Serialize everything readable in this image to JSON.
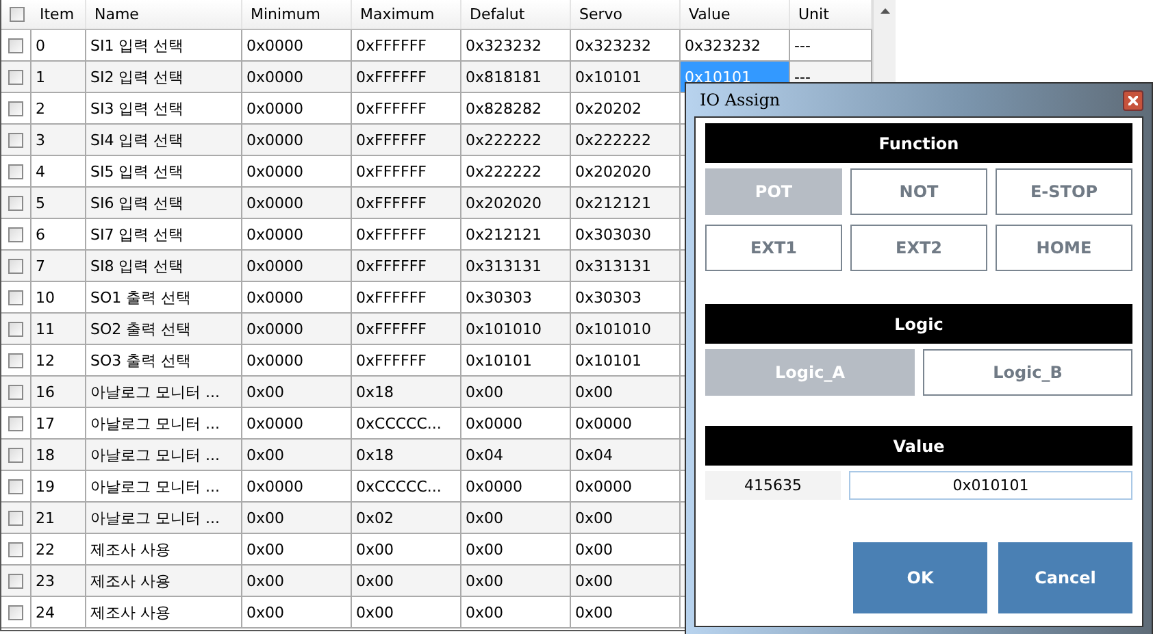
{
  "table": {
    "header_checked": false,
    "columns": [
      "Item",
      "Name",
      "Minimum",
      "Maximum",
      "Defalut",
      "Servo",
      "Value",
      "Unit"
    ],
    "rows": [
      {
        "checked": false,
        "cells": [
          "0",
          "SI1 입력 선택",
          "0x0000",
          "0xFFFFFF",
          "0x323232",
          "0x323232",
          "0x323232",
          "---"
        ],
        "value_selected": false
      },
      {
        "checked": false,
        "cells": [
          "1",
          "SI2 입력 선택",
          "0x0000",
          "0xFFFFFF",
          "0x818181",
          "0x10101",
          "0x10101",
          "---"
        ],
        "value_selected": true
      },
      {
        "checked": false,
        "cells": [
          "2",
          "SI3 입력 선택",
          "0x0000",
          "0xFFFFFF",
          "0x828282",
          "0x20202"
        ]
      },
      {
        "checked": false,
        "cells": [
          "3",
          "SI4 입력 선택",
          "0x0000",
          "0xFFFFFF",
          "0x222222",
          "0x222222"
        ]
      },
      {
        "checked": false,
        "cells": [
          "4",
          "SI5 입력 선택",
          "0x0000",
          "0xFFFFFF",
          "0x222222",
          "0x202020"
        ]
      },
      {
        "checked": false,
        "cells": [
          "5",
          "SI6 입력 선택",
          "0x0000",
          "0xFFFFFF",
          "0x202020",
          "0x212121"
        ]
      },
      {
        "checked": false,
        "cells": [
          "6",
          "SI7 입력 선택",
          "0x0000",
          "0xFFFFFF",
          "0x212121",
          "0x303030"
        ]
      },
      {
        "checked": false,
        "cells": [
          "7",
          "SI8 입력 선택",
          "0x0000",
          "0xFFFFFF",
          "0x313131",
          "0x313131"
        ]
      },
      {
        "checked": false,
        "cells": [
          "10",
          "SO1 출력 선택",
          "0x0000",
          "0xFFFFFF",
          "0x30303",
          "0x30303"
        ]
      },
      {
        "checked": false,
        "cells": [
          "11",
          "SO2 출력 선택",
          "0x0000",
          "0xFFFFFF",
          "0x101010",
          "0x101010"
        ]
      },
      {
        "checked": false,
        "cells": [
          "12",
          "SO3 출력 선택",
          "0x0000",
          "0xFFFFFF",
          "0x10101",
          "0x10101"
        ]
      },
      {
        "checked": false,
        "cells": [
          "16",
          "아날로그 모니터 ...",
          "0x00",
          "0x18",
          "0x00",
          "0x00"
        ]
      },
      {
        "checked": false,
        "cells": [
          "17",
          "아날로그 모니터 ...",
          "0x0000",
          "0xCCCCC...",
          "0x0000",
          "0x0000"
        ]
      },
      {
        "checked": false,
        "cells": [
          "18",
          "아날로그 모니터 ...",
          "0x00",
          "0x18",
          "0x04",
          "0x04"
        ]
      },
      {
        "checked": false,
        "cells": [
          "19",
          "아날로그 모니터 ...",
          "0x0000",
          "0xCCCCC...",
          "0x0000",
          "0x0000"
        ]
      },
      {
        "checked": false,
        "cells": [
          "21",
          "아날로그 모니터 ...",
          "0x00",
          "0x02",
          "0x00",
          "0x00"
        ]
      },
      {
        "checked": false,
        "cells": [
          "22",
          "제조사 사용",
          "0x00",
          "0x00",
          "0x00",
          "0x00"
        ]
      },
      {
        "checked": false,
        "cells": [
          "23",
          "제조사 사용",
          "0x00",
          "0x00",
          "0x00",
          "0x00"
        ]
      },
      {
        "checked": false,
        "cells": [
          "24",
          "제조사 사용",
          "0x00",
          "0x00",
          "0x00",
          "0x00"
        ]
      }
    ]
  },
  "dialog": {
    "title": "IO Assign",
    "function": {
      "header": "Function",
      "buttons": [
        {
          "label": "POT",
          "selected": true
        },
        {
          "label": "NOT",
          "selected": false
        },
        {
          "label": "E-STOP",
          "selected": false
        },
        {
          "label": "EXT1",
          "selected": false
        },
        {
          "label": "EXT2",
          "selected": false
        },
        {
          "label": "HOME",
          "selected": false
        }
      ]
    },
    "logic": {
      "header": "Logic",
      "buttons": [
        {
          "label": "Logic_A",
          "selected": true
        },
        {
          "label": "Logic_B",
          "selected": false
        }
      ]
    },
    "value": {
      "header": "Value",
      "reading": "415635",
      "input": "0x010101"
    },
    "buttons": [
      "OK",
      "Cancel"
    ]
  }
}
